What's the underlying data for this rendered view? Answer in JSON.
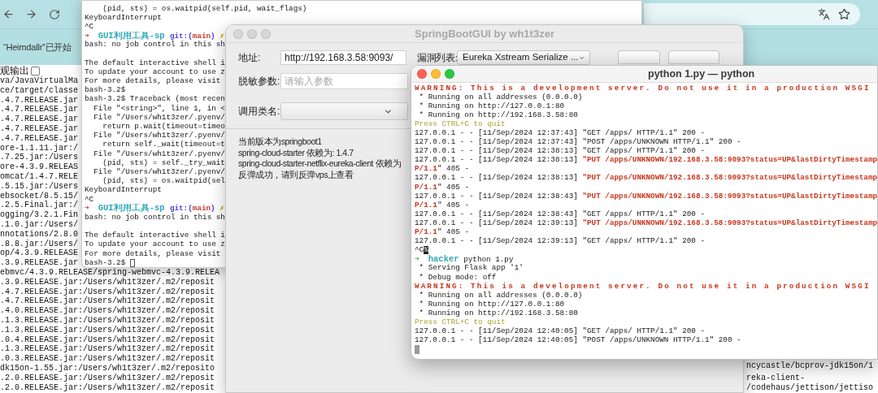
{
  "browser": {
    "notification": "“Heimdallr”已开始",
    "output_toggle": {
      "label": "观输出",
      "checked": false
    },
    "page_lines_left": [
      "va/JavaVirtualMa",
      "ce/target/classe",
      ".4.7.RELEASE.jar",
      ".4.7.RELEASE.jar",
      ".4.7.RELEASE.jar",
      ".4.7.RELEASE.jar",
      ".4.7.RELEASE.jar",
      "ore-1.1.11.jar:/",
      ".7.25.jar:/Users",
      "ore-4.3.9.RELEAS",
      "omcat/1.4.7.RELE",
      ".5.15.jar:/Users",
      "ebsocket/8.5.15/",
      ".2.5.Final.jar:/",
      "ogging/3.2.1.Fin",
      ".1.0.jar:/Users/",
      "nnotations/2.8.0",
      ".8.8.jar:/Users/",
      "op/4.3.9.RELEASE",
      ".3.9.RELEASE.jar",
      "ebmvc/4.3.9.RELEASE/spring-webmvc-4.3.9.RELEA",
      ".3.9.RELEASE.jar:/Users/wh1t3zer/.m2/reposit",
      ".4.7.RELEASE.jar:/Users/wh1t3zer/.m2/reposit",
      ".4.7.RELEASE.jar:/Users/wh1t3zer/.m2/reposit",
      ".4.0.RELEASE.jar:/Users/wh1t3zer/.m2/reposit",
      ".1.3.RELEASE.jar:/Users/wh1t3zer/.m2/reposit",
      ".1.3.RELEASE.jar:/Users/wh1t3zer/.m2/reposit",
      ".0.4.RELEASE.jar:/Users/wh1t3zer/.m2/reposit",
      ".1.3.RELEASE.jar:/Users/wh1t3zer/.m2/reposit",
      ".0.3.RELEASE.jar:/Users/wh1t3zer/.m2/reposit",
      "dk15on-1.55.jar:/Users/wh1t3zer/.m2/reposito",
      ".2.0.RELEASE.jar:/Users/wh1t3zer/.m2/reposit",
      ".2.0.RELEASE.jar:/Users/wh1t3zer/.m2/reposit"
    ],
    "page_lines_right": [
      {
        "kind": "text",
        "text": "ncycastle/bcprov-jdk15on/1"
      },
      {
        "kind": "blank"
      },
      {
        "kind": "text",
        "text": "reka-client-"
      },
      {
        "kind": "text",
        "text": "/codehaus/jettison/jettiso"
      }
    ]
  },
  "terminal_back": {
    "lines": [
      {
        "kind": "text",
        "segments": [
          {
            "kind": "plain",
            "text": "    (pid, sts) = os.waitpid(self.pid, wait_flags)"
          }
        ]
      },
      {
        "kind": "text",
        "segments": [
          {
            "kind": "plain",
            "text": "KeyboardInterrupt"
          }
        ]
      },
      {
        "kind": "text",
        "segments": [
          {
            "kind": "plain",
            "text": "^C"
          }
        ]
      },
      {
        "kind": "text",
        "segments": [
          {
            "kind": "arrow_red",
            "text": "➜  "
          },
          {
            "kind": "cyan",
            "text": "GUI利用工具-sp "
          },
          {
            "kind": "blue",
            "text": "git:("
          },
          {
            "kind": "main",
            "text": "main"
          },
          {
            "kind": "blue",
            "text": ")"
          },
          {
            "kind": "mark",
            "text": " ✗"
          }
        ]
      },
      {
        "kind": "text",
        "segments": [
          {
            "kind": "plain",
            "text": "bash: no job control in this sh"
          }
        ]
      },
      {
        "kind": "blank"
      },
      {
        "kind": "text",
        "segments": [
          {
            "kind": "plain",
            "text": "The default interactive shell i"
          }
        ]
      },
      {
        "kind": "text",
        "segments": [
          {
            "kind": "plain",
            "text": "To update your account to use z"
          }
        ]
      },
      {
        "kind": "text",
        "segments": [
          {
            "kind": "plain",
            "text": "For more details, please visit"
          }
        ]
      },
      {
        "kind": "text",
        "segments": [
          {
            "kind": "plain",
            "text": "bash-3.2$"
          }
        ]
      },
      {
        "kind": "text",
        "segments": [
          {
            "kind": "plain",
            "text": "bash-3.2$ Traceback (most recen"
          }
        ]
      },
      {
        "kind": "text",
        "segments": [
          {
            "kind": "plain",
            "text": "  File \"<string>\", line 1, in <"
          }
        ]
      },
      {
        "kind": "text",
        "segments": [
          {
            "kind": "plain",
            "text": "  File \"/Users/wh1t3zer/.pyenv/"
          }
        ]
      },
      {
        "kind": "text",
        "segments": [
          {
            "kind": "plain",
            "text": "    return p.wait(timeout=timeo"
          }
        ]
      },
      {
        "kind": "text",
        "segments": [
          {
            "kind": "plain",
            "text": "  File \"/Users/wh1t3zer/.pyenv/"
          }
        ]
      },
      {
        "kind": "text",
        "segments": [
          {
            "kind": "plain",
            "text": "    return self._wait(timeout=t"
          }
        ]
      },
      {
        "kind": "text",
        "segments": [
          {
            "kind": "plain",
            "text": "  File \"/Users/wh1t3zer/.pyenv/"
          }
        ]
      },
      {
        "kind": "text",
        "segments": [
          {
            "kind": "plain",
            "text": "    (pid, sts) = self._try_wait"
          }
        ]
      },
      {
        "kind": "text",
        "segments": [
          {
            "kind": "plain",
            "text": "  File \"/Users/wh1t3zer/.pyenv/"
          }
        ]
      },
      {
        "kind": "text",
        "segments": [
          {
            "kind": "plain",
            "text": "    (pid, sts) = os.waitpid(sel"
          }
        ]
      },
      {
        "kind": "text",
        "segments": [
          {
            "kind": "plain",
            "text": "KeyboardInterrupt"
          }
        ]
      },
      {
        "kind": "text",
        "segments": [
          {
            "kind": "plain",
            "text": "^C"
          }
        ]
      },
      {
        "kind": "text",
        "segments": [
          {
            "kind": "arrow_red",
            "text": "➜  "
          },
          {
            "kind": "cyan",
            "text": "GUI利用工具-sp "
          },
          {
            "kind": "blue",
            "text": "git:("
          },
          {
            "kind": "main",
            "text": "main"
          },
          {
            "kind": "blue",
            "text": ")"
          },
          {
            "kind": "mark",
            "text": " ✗"
          }
        ]
      },
      {
        "kind": "text",
        "segments": [
          {
            "kind": "plain",
            "text": "bash: no job control in this sh"
          }
        ]
      },
      {
        "kind": "blank"
      },
      {
        "kind": "text",
        "segments": [
          {
            "kind": "plain",
            "text": "The default interactive shell i"
          }
        ]
      },
      {
        "kind": "text",
        "segments": [
          {
            "kind": "plain",
            "text": "To update your account to use z"
          }
        ]
      },
      {
        "kind": "text",
        "segments": [
          {
            "kind": "plain",
            "text": "For more details, please visit"
          }
        ]
      },
      {
        "kind": "text",
        "segments": [
          {
            "kind": "plain",
            "text": "bash-3.2$ "
          },
          {
            "kind": "cursor_hollow"
          }
        ]
      }
    ]
  },
  "gui_window": {
    "title": "SpringBootGUI by wh1t3zer",
    "active": false,
    "address_label": "地址:",
    "address_value": "http://192.168.3.58:9093/",
    "vuln_label": "漏洞列表:",
    "vuln_value": "Eureka Xstream Serialize ...",
    "param_label": "脱敏参数:",
    "param_placeholder": "请输入参数",
    "class_label": "调用类名:",
    "output": [
      "当前版本为springboot1",
      "spring-cloud-starter 依赖为: 1.4.7",
      "spring-cloud-starter-netflix-eureka-client 依赖为",
      "反弹成功，请到反弹vps上查看"
    ]
  },
  "python_terminal": {
    "title": "python 1.py — python",
    "active": true,
    "lines": [
      {
        "kind": "text",
        "segments": [
          {
            "kind": "warn",
            "text": "WARNING: This is a development server. Do not use it in a production WSGI"
          }
        ]
      },
      {
        "kind": "text",
        "segments": [
          {
            "kind": "plain",
            "text": " * Running on all addresses (0.0.0.0)"
          }
        ]
      },
      {
        "kind": "text",
        "segments": [
          {
            "kind": "plain",
            "text": " * Running on http://127.0.0.1:80"
          }
        ]
      },
      {
        "kind": "text",
        "segments": [
          {
            "kind": "plain",
            "text": " * Running on http://192.168.3.58:80"
          }
        ]
      },
      {
        "kind": "text",
        "segments": [
          {
            "kind": "yellow",
            "text": "Press CTRL+C to quit"
          }
        ]
      },
      {
        "kind": "text",
        "segments": [
          {
            "kind": "plain",
            "text": "127.0.0.1 - - [11/Sep/2024 12:37:43] \"GET /apps/ HTTP/1.1\" 200 -"
          }
        ]
      },
      {
        "kind": "text",
        "segments": [
          {
            "kind": "plain",
            "text": "127.0.0.1 - - [11/Sep/2024 12:37:43] \"POST /apps/UNKNOWN HTTP/1.1\" 200 -"
          }
        ]
      },
      {
        "kind": "text",
        "segments": [
          {
            "kind": "plain",
            "text": "127.0.0.1 - - [11/Sep/2024 12:38:13] \"GET /apps/ HTTP/1.1\" 200 -"
          }
        ]
      },
      {
        "kind": "text",
        "segments": [
          {
            "kind": "plain",
            "text": "127.0.0.1 - - [11/Sep/2024 12:38:13] "
          },
          {
            "kind": "red",
            "text": "\"PUT /apps/UNKNOWN/192.168.3.58:9093?status=UP&lastDirtyTimestamp"
          }
        ]
      },
      {
        "kind": "text",
        "segments": [
          {
            "kind": "red",
            "text": "P/1.1"
          },
          {
            "kind": "plain",
            "text": "\" 405 -"
          }
        ]
      },
      {
        "kind": "text",
        "segments": [
          {
            "kind": "plain",
            "text": "127.0.0.1 - - [11/Sep/2024 12:38:13] "
          },
          {
            "kind": "red",
            "text": "\"PUT /apps/UNKNOWN/192.168.3.58:9093?status=UP&lastDirtyTimestamp"
          }
        ]
      },
      {
        "kind": "text",
        "segments": [
          {
            "kind": "red",
            "text": "P/1.1"
          },
          {
            "kind": "plain",
            "text": "\" 405 -"
          }
        ]
      },
      {
        "kind": "text",
        "segments": [
          {
            "kind": "plain",
            "text": "127.0.0.1 - - [11/Sep/2024 12:38:43] "
          },
          {
            "kind": "red",
            "text": "\"PUT /apps/UNKNOWN/192.168.3.58:9093?status=UP&lastDirtyTimestamp"
          }
        ]
      },
      {
        "kind": "text",
        "segments": [
          {
            "kind": "red",
            "text": "P/1.1"
          },
          {
            "kind": "plain",
            "text": "\" 405 -"
          }
        ]
      },
      {
        "kind": "text",
        "segments": [
          {
            "kind": "plain",
            "text": "127.0.0.1 - - [11/Sep/2024 12:38:43] \"GET /apps/ HTTP/1.1\" 200 -"
          }
        ]
      },
      {
        "kind": "text",
        "segments": [
          {
            "kind": "plain",
            "text": "127.0.0.1 - - [11/Sep/2024 12:39:13] "
          },
          {
            "kind": "red",
            "text": "\"PUT /apps/UNKNOWN/192.168.3.58:9093?status=UP&lastDirtyTimestamp"
          }
        ]
      },
      {
        "kind": "text",
        "segments": [
          {
            "kind": "red",
            "text": "P/1.1"
          },
          {
            "kind": "plain",
            "text": "\" 405 -"
          }
        ]
      },
      {
        "kind": "text",
        "segments": [
          {
            "kind": "plain",
            "text": "127.0.0.1 - - [11/Sep/2024 12:39:13] \"GET /apps/ HTTP/1.1\" 200 -"
          }
        ]
      },
      {
        "kind": "text",
        "segments": [
          {
            "kind": "plain",
            "text": "^C"
          },
          {
            "kind": "inverse",
            "text": "%"
          }
        ]
      },
      {
        "kind": "text",
        "segments": [
          {
            "kind": "arrow_green",
            "text": "➜  "
          },
          {
            "kind": "cyan",
            "text": "hacker"
          },
          {
            "kind": "plain",
            "text": " python 1.py"
          }
        ]
      },
      {
        "kind": "text",
        "segments": [
          {
            "kind": "plain",
            "text": " * Serving Flask app '1'"
          }
        ]
      },
      {
        "kind": "text",
        "segments": [
          {
            "kind": "plain",
            "text": " * Debug mode: off"
          }
        ]
      },
      {
        "kind": "text",
        "segments": [
          {
            "kind": "warn",
            "text": "WARNING: This is a development server. Do not use it in a production WSGI"
          }
        ]
      },
      {
        "kind": "text",
        "segments": [
          {
            "kind": "plain",
            "text": " * Running on all addresses (0.0.0.0)"
          }
        ]
      },
      {
        "kind": "text",
        "segments": [
          {
            "kind": "plain",
            "text": " * Running on http://127.0.0.1:80"
          }
        ]
      },
      {
        "kind": "text",
        "segments": [
          {
            "kind": "plain",
            "text": " * Running on http://192.168.3.58:80"
          }
        ]
      },
      {
        "kind": "text",
        "segments": [
          {
            "kind": "yellow",
            "text": "Press CTRL+C to quit"
          }
        ]
      },
      {
        "kind": "text",
        "segments": [
          {
            "kind": "plain",
            "text": "127.0.0.1 - - [11/Sep/2024 12:40:05] \"GET /apps/ HTTP/1.1\" 200 -"
          }
        ]
      },
      {
        "kind": "text",
        "segments": [
          {
            "kind": "plain",
            "text": "127.0.0.1 - - [11/Sep/2024 12:40:05] \"POST /apps/UNKNOWN HTTP/1.1\" 200 -"
          }
        ]
      },
      {
        "kind": "text",
        "segments": [
          {
            "kind": "cursor_block"
          }
        ]
      }
    ]
  }
}
